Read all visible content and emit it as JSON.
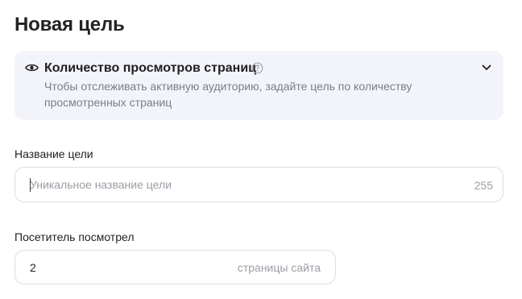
{
  "page": {
    "title": "Новая цель"
  },
  "goal_type": {
    "icon": "eye-icon",
    "title": "Количество просмотров страниц",
    "help_icon": "question-circle-icon",
    "description": "Чтобы отслеживать активную аудиторию, задайте цель по количеству просмотренных страниц",
    "expand_icon": "chevron-down-icon"
  },
  "goal_name": {
    "label": "Название цели",
    "value": "",
    "placeholder": "Уникальное название цели",
    "counter": "255"
  },
  "visitor_viewed": {
    "label": "Посетитель посмотрел",
    "value": "2",
    "suffix": "страницы сайта"
  }
}
